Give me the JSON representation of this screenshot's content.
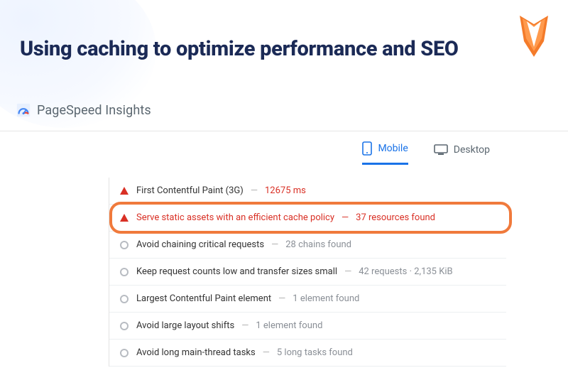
{
  "page_title": "Using caching to optimize performance and SEO",
  "brand_label": "PageSpeed Insights",
  "tabs": {
    "mobile": "Mobile",
    "desktop": "Desktop"
  },
  "audits": [
    {
      "status": "warn",
      "label": "First Contentful Paint (3G)",
      "metric": "12675 ms",
      "metric_style": "red",
      "highlight": false
    },
    {
      "status": "warn",
      "label": "Serve static assets with an efficient cache policy",
      "metric": "37 resources found",
      "metric_style": "red",
      "highlight": true
    },
    {
      "status": "neutral",
      "label": "Avoid chaining critical requests",
      "metric": "28 chains found",
      "metric_style": "grey",
      "highlight": false
    },
    {
      "status": "neutral",
      "label": "Keep request counts low and transfer sizes small",
      "metric": "42 requests · 2,135 KiB",
      "metric_style": "grey",
      "highlight": false
    },
    {
      "status": "neutral",
      "label": "Largest Contentful Paint element",
      "metric": "1 element found",
      "metric_style": "grey",
      "highlight": false
    },
    {
      "status": "neutral",
      "label": "Avoid large layout shifts",
      "metric": "1 element found",
      "metric_style": "grey",
      "highlight": false
    },
    {
      "status": "neutral",
      "label": "Avoid long main-thread tasks",
      "metric": "5 long tasks found",
      "metric_style": "grey",
      "highlight": false
    }
  ]
}
